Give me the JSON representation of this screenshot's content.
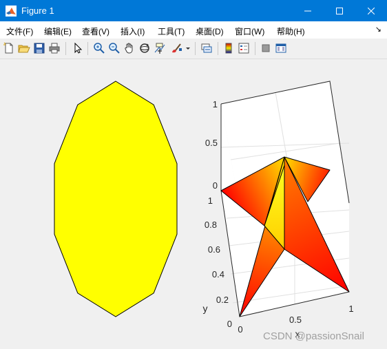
{
  "window": {
    "title": "Figure 1"
  },
  "menu": [
    "文件(F)",
    "编辑(E)",
    "查看(V)",
    "插入(I)",
    "工具(T)",
    "桌面(D)",
    "窗口(W)",
    "帮助(H)"
  ],
  "toolbar_icons": [
    "new-figure-icon",
    "open-file-icon",
    "save-icon",
    "print-icon",
    "pointer-icon",
    "zoom-in-icon",
    "zoom-out-icon",
    "pan-icon",
    "rotate-3d-icon",
    "data-cursor-icon",
    "brush-icon",
    "link-plot-icon",
    "colorbar-icon",
    "legend-icon",
    "hide-plot-tools-icon",
    "show-plot-tools-icon"
  ],
  "axes3d": {
    "z_ticks": [
      "0",
      "0.5",
      "1"
    ],
    "y_ticks": [
      "0",
      "0.2",
      "0.4",
      "0.6",
      "0.8",
      "1"
    ],
    "x_ticks": [
      "0",
      "0.5",
      "1"
    ],
    "xlabel": "x",
    "ylabel": "y"
  },
  "chart_data": [
    {
      "type": "polygon",
      "description_shape": "decagon",
      "fill": "#ffff00",
      "vertices": [
        [
          0.5,
          0
        ],
        [
          0.81,
          0.1
        ],
        [
          1,
          0.35
        ],
        [
          1,
          0.65
        ],
        [
          0.81,
          0.9
        ],
        [
          0.5,
          1
        ],
        [
          0.19,
          0.9
        ],
        [
          0,
          0.65
        ],
        [
          0,
          0.35
        ],
        [
          0.19,
          0.1
        ]
      ]
    },
    {
      "type": "surface3d",
      "colormap": "autumn",
      "xlabel": "x",
      "ylabel": "y",
      "xlim": [
        0,
        1
      ],
      "ylim": [
        0,
        1
      ],
      "zlim": [
        0,
        1
      ],
      "x_ticks": [
        0,
        0.5,
        1
      ],
      "y_ticks": [
        0,
        0.2,
        0.4,
        0.6,
        0.8,
        1
      ],
      "z_ticks": [
        0,
        0.5,
        1
      ]
    }
  ],
  "watermark": "CSDN @passionSnail"
}
